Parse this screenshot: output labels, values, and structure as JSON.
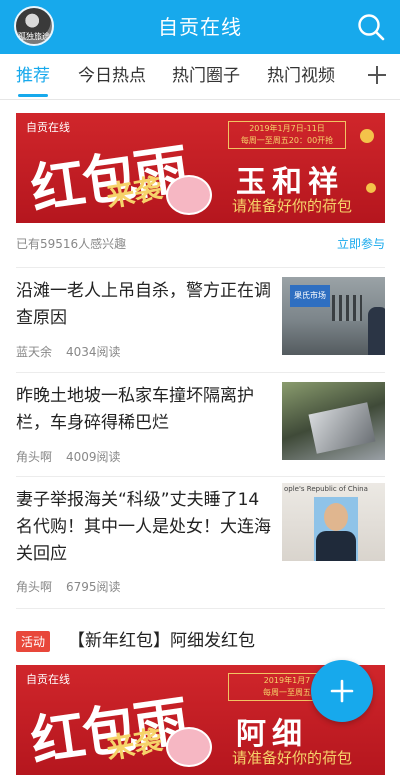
{
  "header": {
    "title": "自贡在线",
    "avatar_text": "孤独旅途"
  },
  "tabs": [
    {
      "label": "推荐",
      "active": true
    },
    {
      "label": "今日热点",
      "active": false
    },
    {
      "label": "热门圈子",
      "active": false
    },
    {
      "label": "热门视频",
      "active": false
    }
  ],
  "banner1": {
    "brand": "自贡在线",
    "headline": "红包雨",
    "sub": "来袭",
    "date_line1": "2019年1月7日-11日",
    "date_line2": "每周一至周五20：00开抢",
    "shop": "玉和祥",
    "slogan": "请准备好你的荷包"
  },
  "promo_meta": {
    "interest": "已有59516人感兴趣",
    "join": "立即参与"
  },
  "news": [
    {
      "title": "沿滩一老人上吊自杀，警方正在调查原因",
      "author": "蓝天余",
      "reads": "4034阅读"
    },
    {
      "title": "昨晚土地坡一私家车撞坏隔离护栏，车身碎得稀巴烂",
      "author": "角头啊",
      "reads": "4009阅读"
    },
    {
      "title": "妻子举报海关“科级”丈夫睡了14名代购！其中一人是处女！大连海关回应",
      "author": "角头啊",
      "reads": "6795阅读"
    }
  ],
  "thumb_text": {
    "sign": "果氏市场",
    "poster": "ople's Republic of China"
  },
  "activity": {
    "badge": "活动",
    "title": "【新年红包】阿细发红包"
  },
  "banner2": {
    "brand": "自贡在线",
    "headline": "红包雨",
    "sub": "来袭",
    "date_line1": "2019年1月7",
    "date_line2": "每周一至周五",
    "shop": "阿细",
    "slogan": "请准备好你的荷包"
  },
  "colors": {
    "accent": "#17a9ec",
    "banner_red": "#c81f26",
    "badge_red": "#e8473a"
  }
}
